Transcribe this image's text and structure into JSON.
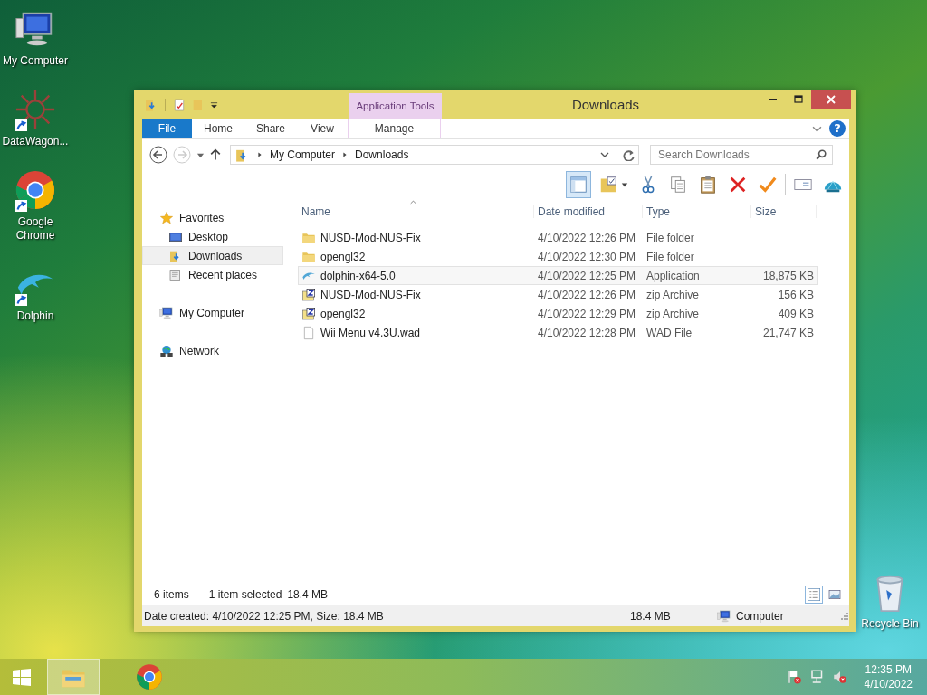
{
  "desktop_icons": [
    {
      "label": "My Computer",
      "kind": "computer",
      "shortcut": false
    },
    {
      "label": "DataWagon...",
      "kind": "datawagon",
      "shortcut": true
    },
    {
      "label": "Google Chrome",
      "kind": "chrome",
      "shortcut": true
    },
    {
      "label": "Dolphin",
      "kind": "dolphin",
      "shortcut": true
    }
  ],
  "recycle_bin": {
    "label": "Recycle Bin"
  },
  "window": {
    "title": "Downloads",
    "quick_access": [
      {
        "kind": "properties"
      },
      {
        "kind": "new-folder"
      }
    ],
    "context_group": "Application Tools",
    "ribbon_tabs": [
      {
        "label": "File",
        "kind": "file"
      },
      {
        "label": "Home",
        "kind": "tab"
      },
      {
        "label": "Share",
        "kind": "tab"
      },
      {
        "label": "View",
        "kind": "tab"
      },
      {
        "label": "Manage",
        "kind": "context"
      }
    ],
    "address": {
      "segments": [
        "My Computer",
        "Downloads"
      ]
    },
    "search": {
      "placeholder": "Search Downloads"
    },
    "help": "?",
    "toolbar": [
      {
        "kind": "layout",
        "selected": true
      },
      {
        "kind": "folder-options",
        "selected": false
      },
      {
        "kind": "cut",
        "selected": false
      },
      {
        "kind": "copy",
        "selected": false
      },
      {
        "kind": "paste",
        "selected": false
      },
      {
        "kind": "delete",
        "selected": false
      },
      {
        "kind": "check",
        "selected": false
      },
      {
        "kind": "rename",
        "selected": false
      },
      {
        "kind": "shell",
        "selected": false
      }
    ],
    "navigation": [
      {
        "label": "Favorites",
        "kind": "favorites",
        "selected": false,
        "children": [
          {
            "label": "Desktop",
            "kind": "desktop",
            "selected": false
          },
          {
            "label": "Downloads",
            "kind": "downloads",
            "selected": true
          },
          {
            "label": "Recent places",
            "kind": "recent",
            "selected": false
          }
        ]
      },
      {
        "label": "My Computer",
        "kind": "computer",
        "selected": false
      },
      {
        "label": "Network",
        "kind": "network",
        "selected": false
      }
    ],
    "columns": [
      "Name",
      "Date modified",
      "Type",
      "Size"
    ],
    "rows": [
      {
        "name": "NUSD-Mod-NUS-Fix",
        "date": "4/10/2022 12:26 PM",
        "type": "File folder",
        "kind": "folder",
        "selected": false
      },
      {
        "name": "opengl32",
        "date": "4/10/2022 12:30 PM",
        "type": "File folder",
        "kind": "folder",
        "selected": false
      },
      {
        "name": "dolphin-x64-5.0",
        "date": "4/10/2022 12:25 PM",
        "type": "Application",
        "size": "18,875 KB",
        "kind": "app",
        "selected": true
      },
      {
        "name": "NUSD-Mod-NUS-Fix",
        "date": "4/10/2022 12:26 PM",
        "type": "zip Archive",
        "size": "156 KB",
        "kind": "zip",
        "selected": false
      },
      {
        "name": "opengl32",
        "date": "4/10/2022 12:29 PM",
        "type": "zip Archive",
        "size": "409 KB",
        "kind": "zip",
        "selected": false
      },
      {
        "name": "Wii Menu v4.3U.wad",
        "date": "4/10/2022 12:28 PM",
        "type": "WAD File",
        "size": "21,747 KB",
        "kind": "file",
        "selected": false
      }
    ],
    "status": {
      "items": "6 items",
      "selection": "1 item selected",
      "selection_size": "18.4 MB",
      "views": [
        {
          "kind": "details",
          "selected": true
        },
        {
          "kind": "large-icons",
          "selected": false
        }
      ]
    },
    "details_bar": {
      "info": "Date created: 4/10/2022 12:25 PM, Size: 18.4 MB",
      "size": "18.4 MB",
      "zone": "Computer"
    }
  },
  "taskbar": {
    "items": [
      {
        "kind": "explorer",
        "active": true
      },
      {
        "kind": "chrome",
        "active": false
      }
    ],
    "tray": [
      {
        "kind": "flag"
      },
      {
        "kind": "network"
      },
      {
        "kind": "volume"
      }
    ],
    "time": "12:35 PM",
    "date": "4/10/2022"
  }
}
